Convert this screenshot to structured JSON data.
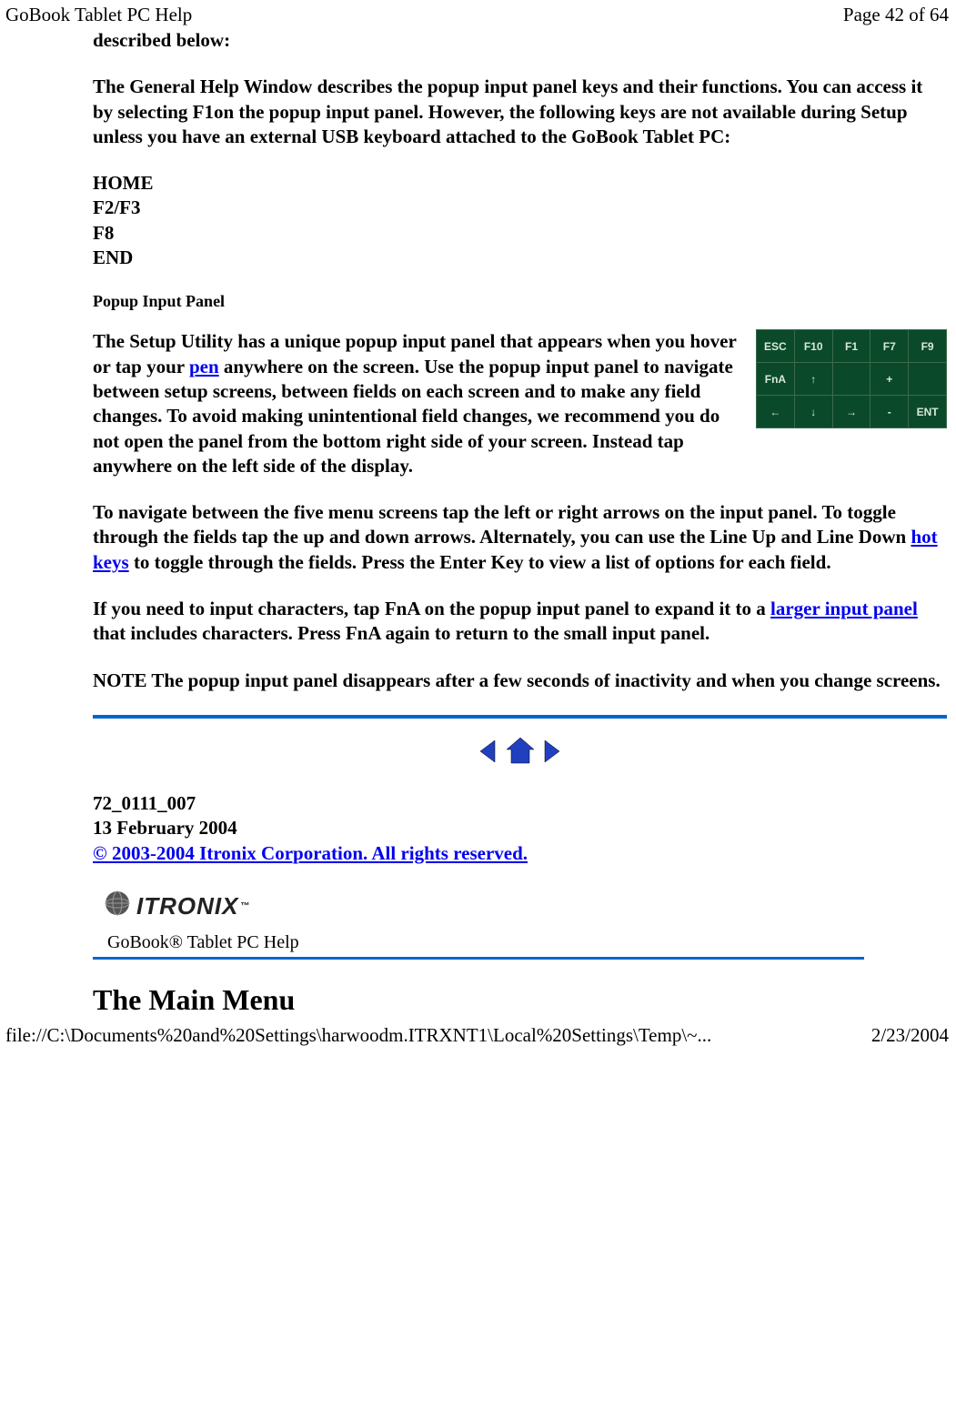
{
  "header": {
    "title": "GoBook Tablet PC Help",
    "page": "Page 42 of 64"
  },
  "body": {
    "intro_tail": "described below:",
    "general_help": "The General Help Window describes the popup input panel keys and their functions.  You can access it by selecting F1on the popup input panel. However, the following keys are not available during Setup unless you have an external USB keyboard attached to the GoBook Tablet PC:",
    "keys": {
      "k1": "HOME",
      "k2": "F2/F3",
      "k3": "F8",
      "k4": "END"
    },
    "popup_heading": "Popup Input Panel",
    "para_setup_1": "The Setup Utility has a unique popup input panel that appears when you hover or tap your ",
    "link_pen": "pen",
    "para_setup_2": " anywhere on the screen.  Use the popup input panel to navigate between setup screens, between fields on each screen and to make any field changes. To avoid making unintentional field changes, we recommend you do not open the panel from the bottom right side of your screen. Instead tap anywhere on the left side of the display.",
    "para_nav_1": "To navigate between the five menu screens tap the left or right arrows on the input panel. To toggle through the fields tap the up and down arrows.  Alternately, you can use the Line Up and Line Down ",
    "link_hotkeys": "hot keys",
    "para_nav_2": " to toggle through the fields. Press the Enter Key to view a list of options for each field.",
    "para_fna_1": "If you need to input characters, tap FnA on the popup input panel to expand it to a ",
    "link_larger": "larger input panel",
    "para_fna_2": " that includes characters.  Press FnA again to return to the small input panel.",
    "note": "NOTE  The popup input panel disappears after a few seconds of inactivity and when you change screens.",
    "panel": {
      "r0c0": "ESC",
      "r0c1": "F10",
      "r0c2": "F1",
      "r0c3": "F7",
      "r0c4": "F9",
      "r1c0": "FnA",
      "r1c1": "↑",
      "r1c2": "",
      "r1c3": "+",
      "r1c4": "",
      "r2c0": "←",
      "r2c1": "↓",
      "r2c2": "→",
      "r2c3": "-",
      "r2c4": "ENT"
    }
  },
  "meta": {
    "doc_num": "72_0111_007",
    "date": "13 February 2004",
    "copyright": "© 2003-2004 Itronix Corporation.  All rights reserved."
  },
  "brand": {
    "name": "ITRONIX",
    "product": "GoBook® Tablet PC Help"
  },
  "main_heading": "The Main Menu",
  "footer": {
    "path": "file://C:\\Documents%20and%20Settings\\harwoodm.ITRXNT1\\Local%20Settings\\Temp\\~...",
    "date": "2/23/2004"
  }
}
